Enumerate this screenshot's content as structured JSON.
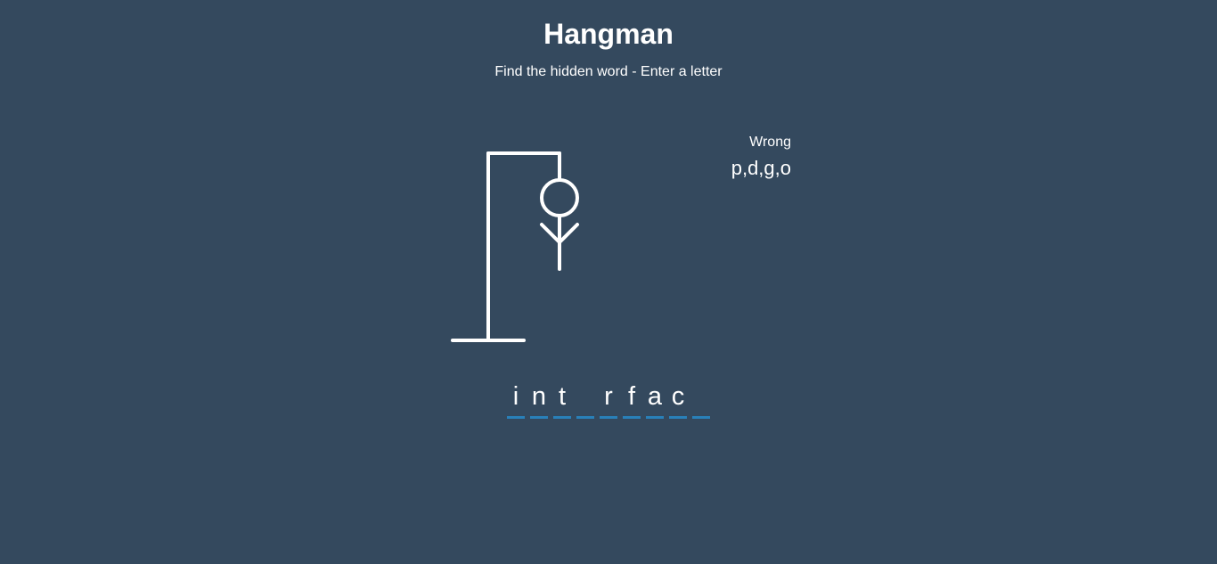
{
  "header": {
    "title": "Hangman",
    "subtitle": "Find the hidden word - Enter a letter"
  },
  "wrong": {
    "title": "Wrong",
    "letters": "p,d,g,o"
  },
  "word": {
    "letters": [
      "i",
      "n",
      "t",
      "",
      "r",
      "f",
      "a",
      "c",
      ""
    ]
  },
  "colors": {
    "background": "#34495e",
    "text": "#ffffff",
    "underline": "#2980b9"
  }
}
